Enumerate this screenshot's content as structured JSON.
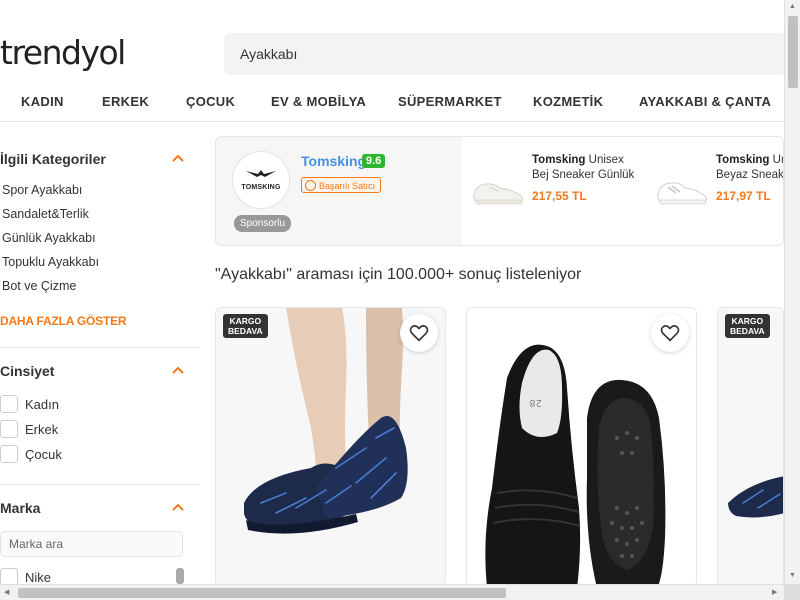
{
  "header": {
    "logo": "trendyol",
    "search_value": "Ayakkabı"
  },
  "nav": [
    "KADIN",
    "ERKEK",
    "ÇOCUK",
    "EV & MOBİLYA",
    "SÜPERMARKET",
    "KOZMETİK",
    "AYAKKABI & ÇANTA"
  ],
  "sidebar": {
    "categories": {
      "title": "İlgili Kategoriler",
      "items": [
        "Spor Ayakkabı",
        "Sandalet&Terlik",
        "Günlük Ayakkabı",
        "Topuklu Ayakkabı",
        "Bot ve Çizme"
      ],
      "more_label": "DAHA FAZLA GÖSTER"
    },
    "gender": {
      "title": "Cinsiyet",
      "options": [
        "Kadın",
        "Erkek",
        "Çocuk"
      ]
    },
    "brand": {
      "title": "Marka",
      "search_placeholder": "Marka ara",
      "options": [
        "Nike"
      ]
    }
  },
  "banner": {
    "store_name": "Tomsking",
    "store_logo_text": "TOMSKING",
    "score": "9.6",
    "seller_badge": "Başarılı Satıcı",
    "sponsored_label": "Sponsorlu",
    "products": [
      {
        "brand": "Tomsking",
        "title": "Unisex Bej Sneaker Günlük",
        "price": "217,55 TL"
      },
      {
        "brand": "Tomsking",
        "title": "Unisex Beyaz Sneaker",
        "price": "217,97 TL"
      }
    ]
  },
  "results_text": "\"Ayakkabı\" araması için 100.000+ sonuç listeleniyor",
  "product_cards": [
    {
      "badge_line1": "KARGO",
      "badge_line2": "BEDAVA",
      "has_badge": true
    },
    {
      "badge_line1": "",
      "badge_line2": "",
      "has_badge": false
    },
    {
      "badge_line1": "KARGO",
      "badge_line2": "BEDAVA",
      "has_badge": true
    }
  ],
  "colors": {
    "accent": "#f27a1a",
    "store_name": "#4a90e2",
    "score_bg": "#2eb82e"
  }
}
